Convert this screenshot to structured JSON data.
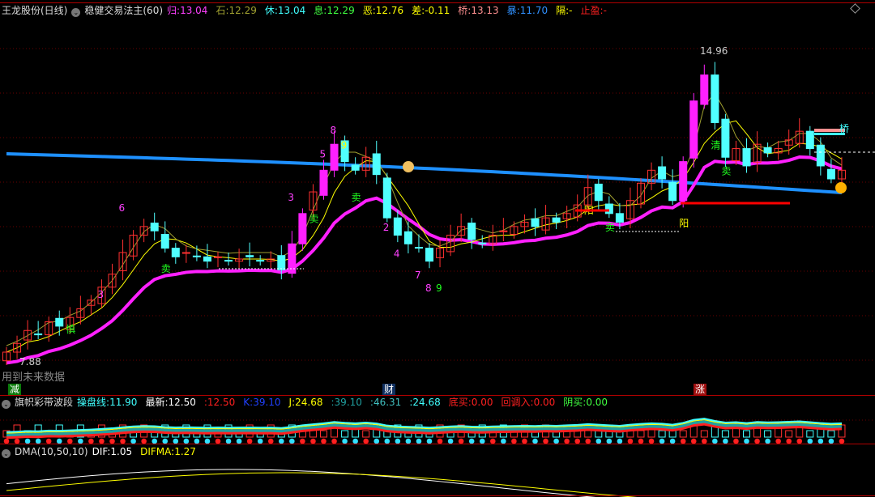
{
  "main_header": {
    "stock": "王龙股份(日线)",
    "indicator": "稳健交易法主(60)",
    "items": [
      {
        "label": "归",
        "value": "13.04",
        "color": "#ff40ff"
      },
      {
        "label": "石",
        "value": "12.29",
        "color": "#a0a030"
      },
      {
        "label": "休",
        "value": "13.04",
        "color": "#40ffff"
      },
      {
        "label": "息",
        "value": "12.29",
        "color": "#40ff40"
      },
      {
        "label": "恶",
        "value": "12.76",
        "color": "#ffff00"
      },
      {
        "label": "差",
        "value": "-0.11",
        "color": "#ffff00"
      },
      {
        "label": "桥",
        "value": "13.13",
        "color": "#ff9090"
      },
      {
        "label": "暴",
        "value": "11.70",
        "color": "#3090ff"
      },
      {
        "label": "隔",
        "value": "-",
        "color": "#ffff00"
      },
      {
        "label": "止盈",
        "value": "-",
        "color": "#ff2020"
      }
    ]
  },
  "main_labels": {
    "high_price": "14.96",
    "low_price": "7.88",
    "future_data_note": "用到未来数据",
    "bridge_label": "桥"
  },
  "markers": {
    "jian": "减",
    "cai": "财",
    "zhang": "涨"
  },
  "sub1_header": {
    "title": "旗帜彩带波段",
    "items": [
      {
        "label": "操盘线",
        "value": "11.90",
        "color": "#40ffff"
      },
      {
        "label": "最新",
        "value": "12.50",
        "color": "#ffffff"
      },
      {
        "label": "",
        "value": "12.50",
        "color": "#ff2020"
      },
      {
        "label": "K",
        "value": "39.10",
        "color": "#2040ff"
      },
      {
        "label": "J",
        "value": "24.68",
        "color": "#ffff00"
      },
      {
        "label": "",
        "value": "39.10",
        "color": "#20a0a0"
      },
      {
        "label": "",
        "value": "46.31",
        "color": "#40c0c0"
      },
      {
        "label": "",
        "value": "24.68",
        "color": "#40ffff"
      },
      {
        "label": "底买",
        "value": "0.00",
        "color": "#ff2020"
      },
      {
        "label": "回调入",
        "value": "0.00",
        "color": "#ff2020"
      },
      {
        "label": "阴买",
        "value": "0.00",
        "color": "#40ff40"
      }
    ]
  },
  "sub2_header": {
    "title": "DMA(10,50,10)",
    "items": [
      {
        "label": "DIF",
        "value": "1.05",
        "color": "#ffffff"
      },
      {
        "label": "DIFMA",
        "value": "1.27",
        "color": "#ffff00"
      }
    ]
  },
  "chart_data": {
    "type": "candlestick",
    "ylim": [
      7.6,
      15.3
    ],
    "closes": [
      8.1,
      8.3,
      8.6,
      8.5,
      8.8,
      8.7,
      8.9,
      9.1,
      9.3,
      9.6,
      9.9,
      10.4,
      10.8,
      11.0,
      10.9,
      10.5,
      10.3,
      10.4,
      10.3,
      10.2,
      10.3,
      10.2,
      10.25,
      10.3,
      10.2,
      10.25,
      10.0,
      10.6,
      11.3,
      11.8,
      12.3,
      12.9,
      12.5,
      12.3,
      12.6,
      12.2,
      11.2,
      10.8,
      10.6,
      10.5,
      10.2,
      10.5,
      10.8,
      11.0,
      10.7,
      10.6,
      10.8,
      10.9,
      11.0,
      11.1,
      11.0,
      11.2,
      11.1,
      11.3,
      11.5,
      11.9,
      11.6,
      11.3,
      11.1,
      11.6,
      12.0,
      12.3,
      12.1,
      11.6,
      12.5,
      13.9,
      14.5,
      13.4,
      12.6,
      12.8,
      12.4,
      12.9,
      12.7,
      12.8,
      13.0,
      13.2,
      12.8,
      12.4,
      12.1,
      12.3
    ],
    "annotations": [
      {
        "i": 6,
        "p": 8.55,
        "text": "慎",
        "color": "#20ff20"
      },
      {
        "i": 15,
        "p": 9.95,
        "text": "卖",
        "color": "#20ff20"
      },
      {
        "i": 29,
        "p": 11.1,
        "text": "卖",
        "color": "#20ff20"
      },
      {
        "i": 33,
        "p": 11.6,
        "text": "卖",
        "color": "#20ff20"
      },
      {
        "i": 55,
        "p": 11.3,
        "text": "阳",
        "color": "#ffff00"
      },
      {
        "i": 57,
        "p": 10.9,
        "text": "卖",
        "color": "#20ff20"
      },
      {
        "i": 64,
        "p": 11.0,
        "text": "阳",
        "color": "#ffff00"
      },
      {
        "i": 67,
        "p": 12.8,
        "text": "清",
        "color": "#20ff20"
      },
      {
        "i": 68,
        "p": 12.2,
        "text": "卖",
        "color": "#20ff20"
      },
      {
        "i": 11,
        "p": 11.35,
        "text": "6",
        "color": "#ff40ff"
      },
      {
        "i": 9,
        "p": 9.35,
        "text": "3",
        "color": "#ff40ff"
      },
      {
        "i": 27,
        "p": 11.6,
        "text": "3",
        "color": "#ff40ff"
      },
      {
        "i": 30,
        "p": 12.6,
        "text": "5",
        "color": "#ff40ff"
      },
      {
        "i": 31,
        "p": 13.15,
        "text": "8",
        "color": "#ff40ff"
      },
      {
        "i": 36,
        "p": 10.9,
        "text": "2",
        "color": "#ff40ff"
      },
      {
        "i": 37,
        "p": 10.3,
        "text": "4",
        "color": "#ff40ff"
      },
      {
        "i": 39,
        "p": 9.8,
        "text": "7",
        "color": "#ff40ff"
      },
      {
        "i": 40,
        "p": 9.5,
        "text": "8",
        "color": "#ff40ff"
      },
      {
        "i": 41,
        "p": 9.5,
        "text": "9",
        "color": "#20ff20"
      },
      {
        "i": 32,
        "p": 12.8,
        "text": "9",
        "color": "#ffff00"
      }
    ],
    "series": [
      {
        "name": "暴",
        "color": "#1e90ff"
      },
      {
        "name": "归",
        "color": "#ff20ff"
      },
      {
        "name": "恶",
        "color": "#ffff00"
      },
      {
        "name": "石",
        "color": "#a0a030"
      }
    ]
  }
}
